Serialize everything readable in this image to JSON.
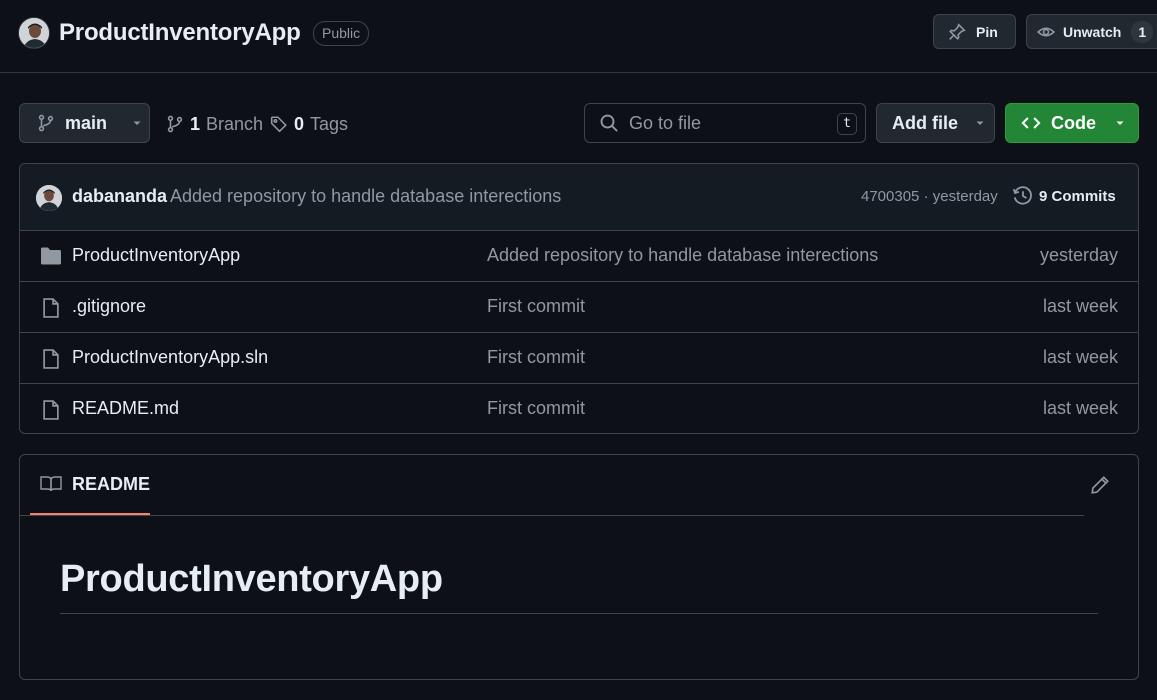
{
  "repo": {
    "name": "ProductInventoryApp",
    "visibility": "Public"
  },
  "header_actions": {
    "pin_label": "Pin",
    "watch_label": "Unwatch",
    "watch_count": "1"
  },
  "toolbar": {
    "branch": "main",
    "branches_count": "1",
    "branches_label": "Branch",
    "tags_count": "0",
    "tags_label": "Tags",
    "search_placeholder": "Go to file",
    "search_shortcut": "t",
    "add_file_label": "Add file",
    "code_label": "Code"
  },
  "latest_commit": {
    "author": "dabananda",
    "message": "Added repository to handle database interections",
    "hash_and_time": "4700305 · yesterday",
    "commits_label": "9 Commits"
  },
  "files": [
    {
      "name": "ProductInventoryApp",
      "type": "folder-icon",
      "commit": "Added repository to handle database interections",
      "date": "yesterday"
    },
    {
      "name": ".gitignore",
      "type": "file-icon",
      "commit": "First commit",
      "date": "last week"
    },
    {
      "name": "ProductInventoryApp.sln",
      "type": "file-icon",
      "commit": "First commit",
      "date": "last week"
    },
    {
      "name": "README.md",
      "type": "file-icon",
      "commit": "First commit",
      "date": "last week"
    }
  ],
  "readme": {
    "tab_label": "README",
    "heading": "ProductInventoryApp"
  },
  "colors": {
    "background": "#0d1117",
    "border": "#3d444d",
    "code_button": "#238636",
    "readme_tab_underline": "#f78166",
    "muted_text": "#9198a1"
  }
}
